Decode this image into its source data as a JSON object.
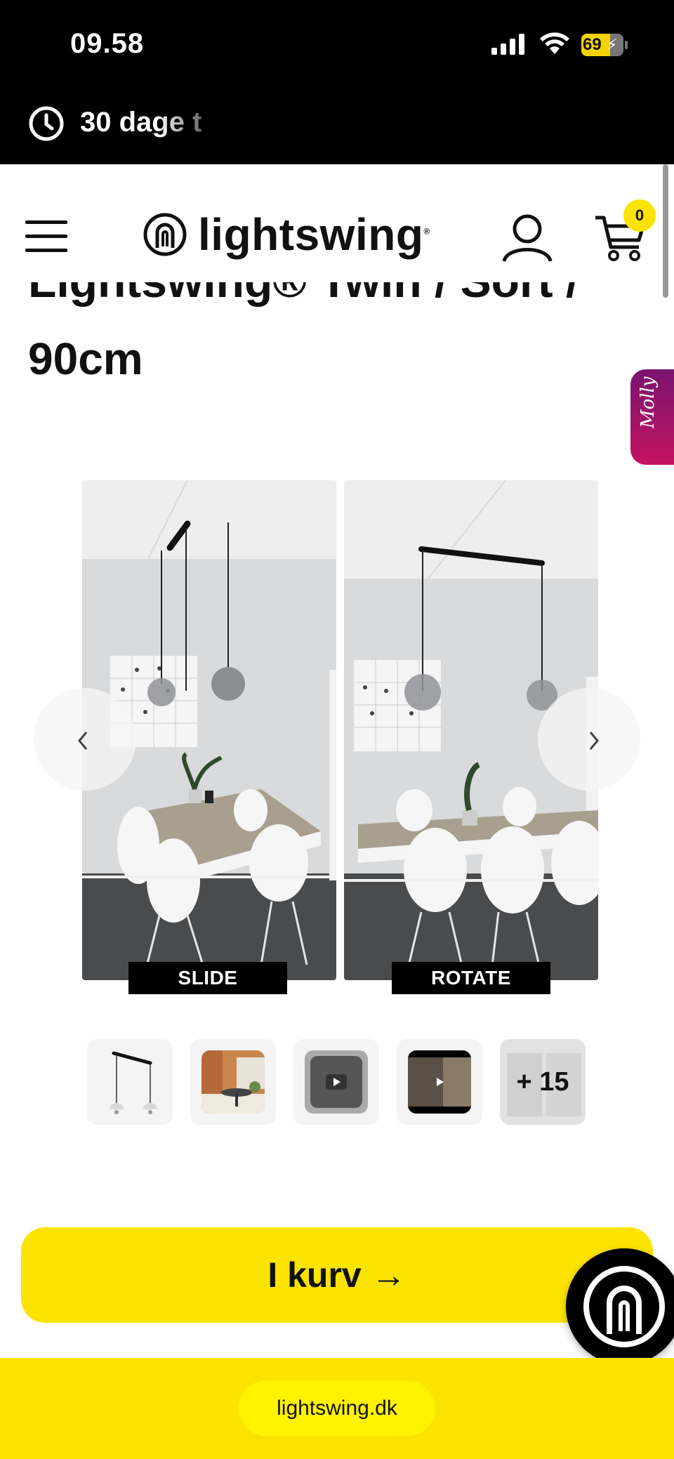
{
  "status_bar": {
    "time": "09.58",
    "battery_percent": "69",
    "battery_level": 0.69,
    "signal_icon": "cellular-signal-icon",
    "wifi_icon": "wifi-icon",
    "battery_icon": "battery-charging-icon"
  },
  "promo": {
    "icon": "clock-icon",
    "text": "30 dage t"
  },
  "header": {
    "brand": "lightswing",
    "brand_mark": "®",
    "menu_icon": "hamburger-menu-icon",
    "account_icon": "user-icon",
    "cart_icon": "shopping-cart-icon",
    "cart_count": "0"
  },
  "product": {
    "title_line_partial": "Lightswing® Twin / Sort / ",
    "title_line_2": "90cm"
  },
  "molly": {
    "label": "Molly"
  },
  "gallery": {
    "images": [
      {
        "label": "SLIDE",
        "scene": "dining-room-pendant-slide"
      },
      {
        "label": "ROTATE",
        "scene": "dining-room-pendant-rotate"
      }
    ],
    "prev_icon": "chevron-left-icon",
    "next_icon": "chevron-right-icon"
  },
  "thumbnails": {
    "items": [
      {
        "name": "product-thumbnail"
      },
      {
        "name": "interior-thumbnail"
      },
      {
        "name": "video-thumbnail"
      },
      {
        "name": "video-thumbnail-2"
      }
    ],
    "more_label": "+ 15"
  },
  "cta": {
    "label": "I kurv →"
  },
  "chat": {
    "icon": "lightswing-chat-icon"
  },
  "footer": {
    "url": "lightswing.dk"
  },
  "colors": {
    "brand_yellow": "#fce300",
    "black": "#000000",
    "molly_gradient_start": "#7a1470",
    "molly_gradient_end": "#c4135f"
  }
}
